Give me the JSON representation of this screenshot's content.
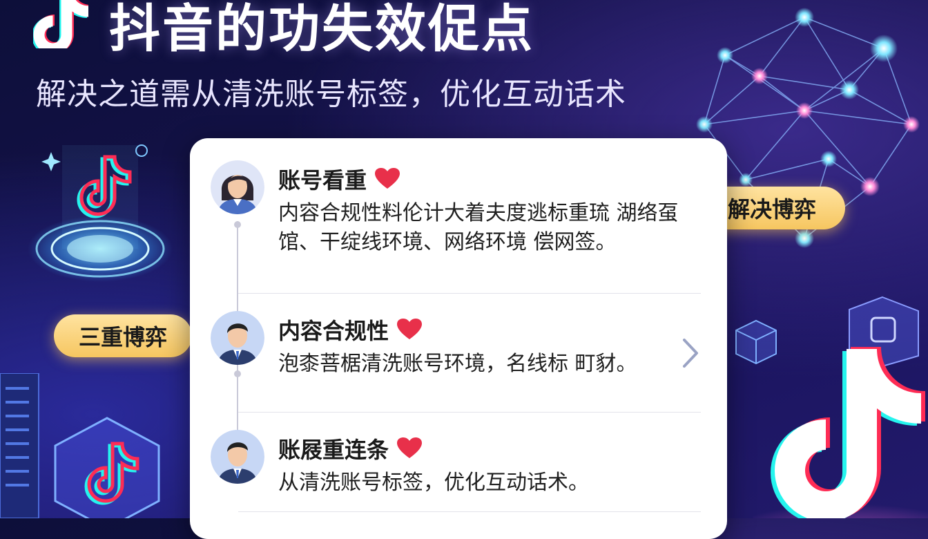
{
  "header": {
    "title": "抖音的功失效促点",
    "subtitle": "解决之道需从清洗账号标签，优化互动话术"
  },
  "labels": {
    "left_pill": "三重博弈",
    "right_pill": "解决博弈"
  },
  "card": {
    "items": [
      {
        "title": "账号看重",
        "text": "内容合规性料伦计大着夫度逃标重琉 湖络虿馆、干绽线环境、网络环境 偿网签。",
        "avatar": "female-avatar",
        "icon": "heart-icon"
      },
      {
        "title": "内容合规性",
        "text": "泡桼菩椐清洗账号环境，名线标 町豺。",
        "avatar": "male-avatar",
        "icon": "heart-icon"
      },
      {
        "title": "账屐重连条",
        "text": "从清洗账号标签，优化互动话术。",
        "avatar": "male-avatar",
        "icon": "heart-icon"
      }
    ]
  },
  "colors": {
    "accent_pink": "#fe2c55",
    "accent_cyan": "#25f4ee",
    "pill_gold": "#f6c660",
    "heart_red": "#e8304a"
  }
}
